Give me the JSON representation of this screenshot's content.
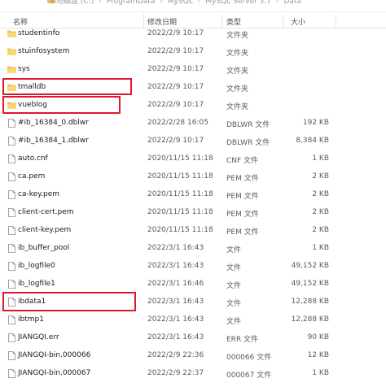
{
  "breadcrumb": {
    "parts": [
      "本地磁盘 (C:)",
      "ProgramData",
      "MySQL",
      "MySQL Server 5.7",
      "Data"
    ]
  },
  "columns": {
    "name": "名称",
    "date": "修改日期",
    "type": "类型",
    "size": "大小"
  },
  "colors": {
    "highlight": "#e0162b",
    "folder": "#f3c350"
  },
  "files": [
    {
      "name": "studentinfo",
      "date": "2022/2/9 10:17",
      "type": "文件夹",
      "size": "",
      "kind": "folder"
    },
    {
      "name": "stuinfosystem",
      "date": "2022/2/9 10:17",
      "type": "文件夹",
      "size": "",
      "kind": "folder"
    },
    {
      "name": "sys",
      "date": "2022/2/9 10:17",
      "type": "文件夹",
      "size": "",
      "kind": "folder"
    },
    {
      "name": "tmalldb",
      "date": "2022/2/9 10:17",
      "type": "文件夹",
      "size": "",
      "kind": "folder"
    },
    {
      "name": "vueblog",
      "date": "2022/2/9 10:17",
      "type": "文件夹",
      "size": "",
      "kind": "folder"
    },
    {
      "name": "#ib_16384_0.dblwr",
      "date": "2022/2/28 16:05",
      "type": "DBLWR 文件",
      "size": "192 KB",
      "kind": "file"
    },
    {
      "name": "#ib_16384_1.dblwr",
      "date": "2022/2/9 10:17",
      "type": "DBLWR 文件",
      "size": "8,384 KB",
      "kind": "file"
    },
    {
      "name": "auto.cnf",
      "date": "2020/11/15 11:18",
      "type": "CNF 文件",
      "size": "1 KB",
      "kind": "file"
    },
    {
      "name": "ca.pem",
      "date": "2020/11/15 11:18",
      "type": "PEM 文件",
      "size": "2 KB",
      "kind": "file"
    },
    {
      "name": "ca-key.pem",
      "date": "2020/11/15 11:18",
      "type": "PEM 文件",
      "size": "2 KB",
      "kind": "file"
    },
    {
      "name": "client-cert.pem",
      "date": "2020/11/15 11:18",
      "type": "PEM 文件",
      "size": "2 KB",
      "kind": "file"
    },
    {
      "name": "client-key.pem",
      "date": "2020/11/15 11:18",
      "type": "PEM 文件",
      "size": "2 KB",
      "kind": "file"
    },
    {
      "name": "ib_buffer_pool",
      "date": "2022/3/1 16:43",
      "type": "文件",
      "size": "1 KB",
      "kind": "file"
    },
    {
      "name": "ib_logfile0",
      "date": "2022/3/1 16:43",
      "type": "文件",
      "size": "49,152 KB",
      "kind": "file"
    },
    {
      "name": "ib_logfile1",
      "date": "2022/3/1 16:46",
      "type": "文件",
      "size": "49,152 KB",
      "kind": "file"
    },
    {
      "name": "ibdata1",
      "date": "2022/3/1 16:43",
      "type": "文件",
      "size": "12,288 KB",
      "kind": "file"
    },
    {
      "name": "ibtmp1",
      "date": "2022/3/1 16:43",
      "type": "文件",
      "size": "12,288 KB",
      "kind": "file"
    },
    {
      "name": "JIANGQI.err",
      "date": "2022/3/1 16:43",
      "type": "ERR 文件",
      "size": "90 KB",
      "kind": "file"
    },
    {
      "name": "JIANGQI-bin.000066",
      "date": "2022/2/9 22:36",
      "type": "000066 文件",
      "size": "12 KB",
      "kind": "file"
    },
    {
      "name": "JIANGQI-bin.000067",
      "date": "2022/2/9 22:37",
      "type": "000067 文件",
      "size": "1 KB",
      "kind": "file"
    }
  ]
}
